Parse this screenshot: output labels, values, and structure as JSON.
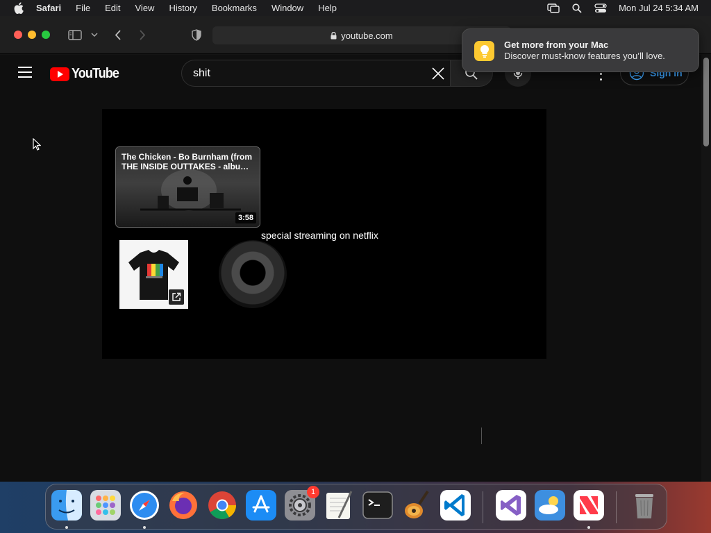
{
  "menubar": {
    "app_name": "Safari",
    "items": [
      "File",
      "Edit",
      "View",
      "History",
      "Bookmarks",
      "Window",
      "Help"
    ],
    "clock": "Mon Jul 24  5:34 AM"
  },
  "browser": {
    "url": "youtube.com"
  },
  "youtube": {
    "logo_text": "YouTube",
    "search": {
      "value": "shit",
      "placeholder": "Search"
    },
    "signin_label": "Sign in"
  },
  "endscreen": {
    "video_title": "The Chicken - Bo Burnham (from THE INSIDE OUTTAKES - albu…",
    "video_duration": "3:58",
    "caption": "special streaming on netflix"
  },
  "notification": {
    "title": "Get more from your Mac",
    "body": "Discover must-know features you’ll love."
  },
  "dock": {
    "apps": [
      {
        "name": "Finder",
        "color": "#3a9bf0"
      },
      {
        "name": "Launchpad",
        "color": "#d9dde3"
      },
      {
        "name": "Safari",
        "color": "#2d8cf0"
      },
      {
        "name": "Firefox",
        "color": "#ff7139"
      },
      {
        "name": "Chrome",
        "color": "#ffffff"
      },
      {
        "name": "App Store",
        "color": "#1c8cf5"
      },
      {
        "name": "System Settings",
        "color": "#8e8e93"
      },
      {
        "name": "TextEdit",
        "color": "#f5f5f0"
      },
      {
        "name": "Terminal",
        "color": "#1e1e1e"
      },
      {
        "name": "GarageBand",
        "color": "#6b4a2c"
      },
      {
        "name": "Visual Studio Code",
        "color": "#ffffff"
      },
      {
        "name": "Visual Studio",
        "color": "#ffffff"
      },
      {
        "name": "Weather",
        "color": "#3d8fe0"
      },
      {
        "name": "News",
        "color": "#ffffff"
      },
      {
        "name": "Trash",
        "color": "#9a9a9a"
      }
    ],
    "settings_badge": "1"
  }
}
